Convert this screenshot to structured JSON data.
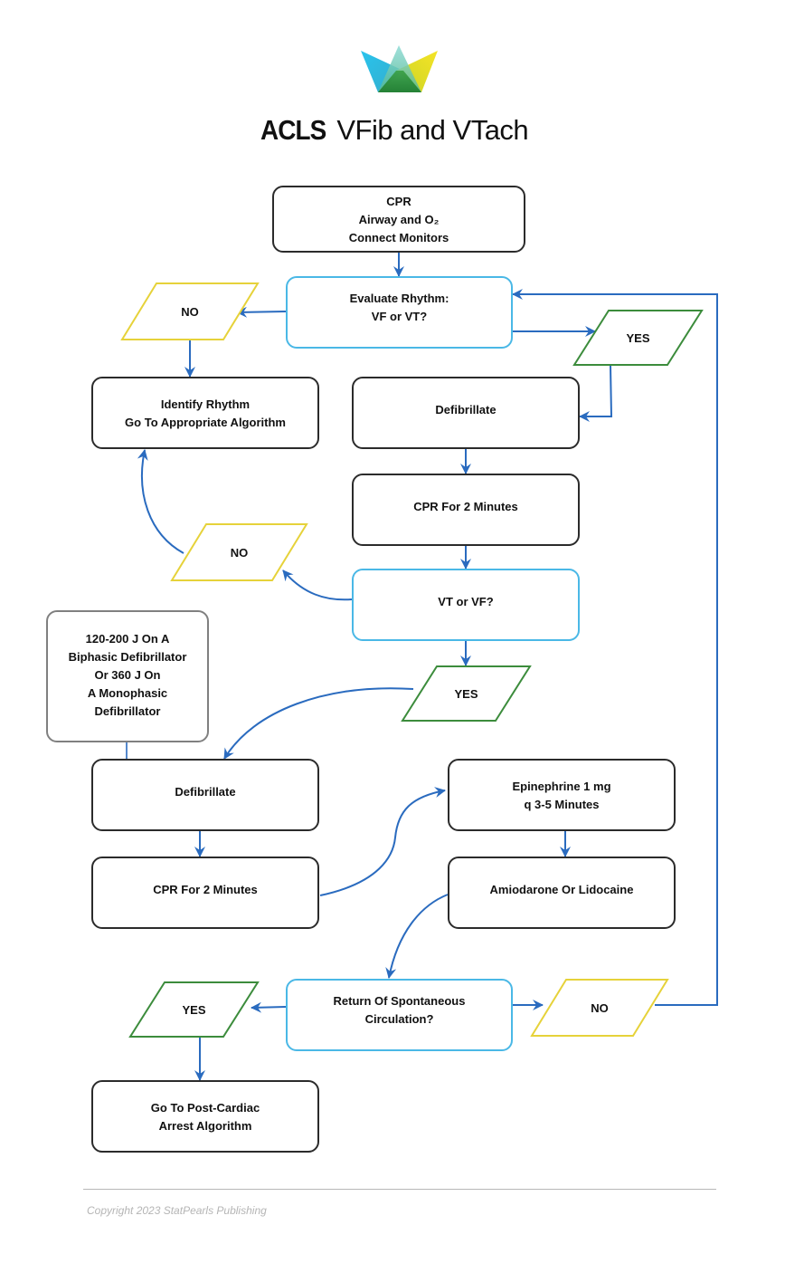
{
  "header": {
    "logo": "crown-logo",
    "title_bold": "ACLS",
    "title_rest": "VFib and VTach"
  },
  "colors": {
    "process_border": "#2b2b2b",
    "decision_border": "#4ab8e6",
    "yes_border": "#3c8c3c",
    "no_border": "#e6d23a",
    "note_border": "#808080",
    "arrow": "#2a6bbf"
  },
  "nodes": {
    "start": [
      "CPR",
      "Airway and O₂",
      "Connect Monitors"
    ],
    "evaluate": [
      "Evaluate Rhythm:",
      "VF or VT?"
    ],
    "no1": [
      "NO"
    ],
    "yes1": [
      "YES"
    ],
    "identify": [
      "Identify Rhythm",
      "Go To Appropriate Algorithm"
    ],
    "defib1": [
      "Defibrillate"
    ],
    "cpr1": [
      "CPR For 2 Minutes"
    ],
    "no2": [
      "NO"
    ],
    "vtvf": [
      "VT or VF?"
    ],
    "energy_note": [
      "120-200 J On A",
      "Biphasic Defibrillator",
      "Or 360 J On",
      "A Monophasic",
      "Defibrillator"
    ],
    "yes2": [
      "YES"
    ],
    "defib2": [
      "Defibrillate"
    ],
    "epi": [
      "Epinephrine 1 mg",
      "q 3-5 Minutes"
    ],
    "cpr2": [
      "CPR For 2 Minutes"
    ],
    "amio": [
      "Amiodarone Or Lidocaine"
    ],
    "rosc": [
      "Return Of Spontaneous",
      "Circulation?"
    ],
    "yes3": [
      "YES"
    ],
    "no3": [
      "NO"
    ],
    "post": [
      "Go To Post-Cardiac",
      "Arrest Algorithm"
    ]
  },
  "footer": {
    "copyright": "Copyright 2023 StatPearls Publishing"
  }
}
